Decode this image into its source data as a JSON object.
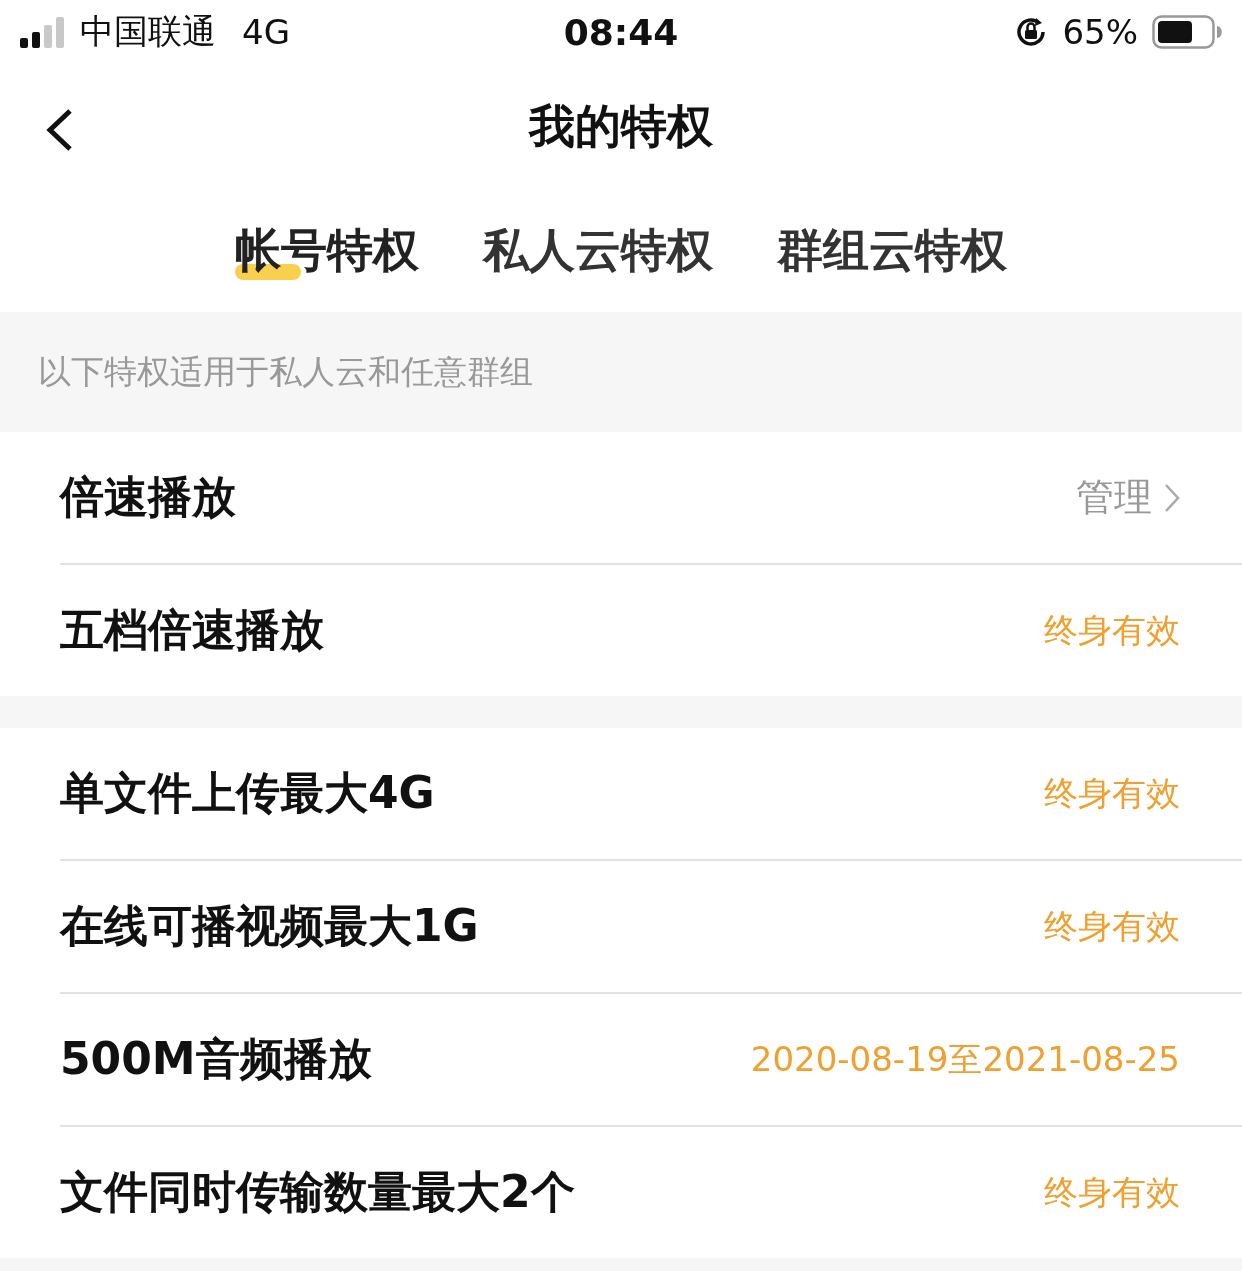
{
  "status_bar": {
    "carrier": "中国联通",
    "network": "4G",
    "time": "08:44",
    "battery": "65%"
  },
  "nav": {
    "title": "我的特权"
  },
  "tabs": [
    {
      "label": "帐号特权",
      "selected": true
    },
    {
      "label": "私人云特权",
      "selected": false
    },
    {
      "label": "群组云特权",
      "selected": false
    }
  ],
  "notice": "以下特权适用于私人云和任意群组",
  "sections": [
    {
      "rows": [
        {
          "kind": "action",
          "label": "倍速播放",
          "action": "管理"
        },
        {
          "kind": "validity",
          "label": "五档倍速播放",
          "validity": "终身有效"
        }
      ]
    },
    {
      "rows": [
        {
          "kind": "validity",
          "label": "单文件上传最大4G",
          "validity": "终身有效"
        },
        {
          "kind": "validity",
          "label": "在线可播视频最大1G",
          "validity": "终身有效"
        },
        {
          "kind": "validity",
          "label": "500M音频播放",
          "validity": "2020-08-19至2021-08-25"
        },
        {
          "kind": "validity",
          "label": "文件同时传输数量最大2个",
          "validity": "终身有效"
        }
      ]
    }
  ]
}
